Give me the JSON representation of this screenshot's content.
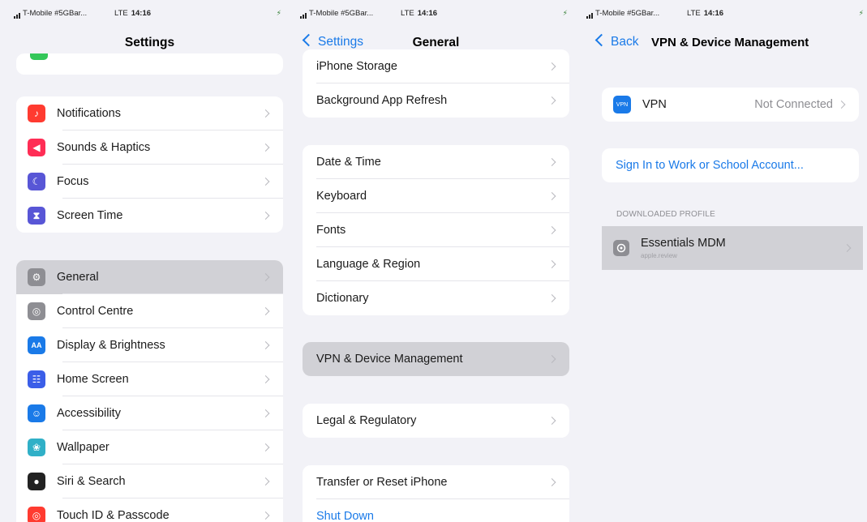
{
  "status": {
    "carrier": "T-Mobile #5GBar...",
    "network": "LTE",
    "time": "14:16",
    "battery": "⚡"
  },
  "screen1": {
    "title": "Settings",
    "group1": [
      {
        "label": "Notifications",
        "icon": "bell-icon",
        "color": "#ff3b30"
      },
      {
        "label": "Sounds & Haptics",
        "icon": "speaker-icon",
        "color": "#ff2d55"
      },
      {
        "label": "Focus",
        "icon": "moon-icon",
        "color": "#5856d6"
      },
      {
        "label": "Screen Time",
        "icon": "hourglass-icon",
        "color": "#5856d6"
      }
    ],
    "group2": [
      {
        "label": "General",
        "icon": "gear-icon",
        "color": "#8e8e93"
      },
      {
        "label": "Control Centre",
        "icon": "toggles-icon",
        "color": "#8e8e93"
      },
      {
        "label": "Display & Brightness",
        "icon": "aa-icon",
        "color": "#1a7ae8"
      },
      {
        "label": "Home Screen",
        "icon": "grid-icon",
        "color": "#3b5ee8"
      },
      {
        "label": "Accessibility",
        "icon": "accessibility-icon",
        "color": "#1a7ae8"
      },
      {
        "label": "Wallpaper",
        "icon": "flower-icon",
        "color": "#30b0c7"
      },
      {
        "label": "Siri & Search",
        "icon": "siri-icon",
        "color": "#222222"
      },
      {
        "label": "Touch ID & Passcode",
        "icon": "fingerprint-icon",
        "color": "#ff3b30"
      }
    ]
  },
  "screen2": {
    "back": "Settings",
    "title": "General",
    "group1": [
      "iPhone Storage",
      "Background App Refresh"
    ],
    "group2": [
      "Date & Time",
      "Keyboard",
      "Fonts",
      "Language & Region",
      "Dictionary"
    ],
    "group3": [
      "VPN & Device Management"
    ],
    "group4": [
      "Legal & Regulatory"
    ],
    "group5": [
      "Transfer or Reset iPhone",
      "Shut Down"
    ]
  },
  "screen3": {
    "back": "Back",
    "title": "VPN & Device Management",
    "vpn_label": "VPN",
    "vpn_icon": "VPN",
    "vpn_status": "Not Connected",
    "sign_in": "Sign In to Work or School Account...",
    "section": "DOWNLOADED PROFILE",
    "profile_name": "Essentials MDM",
    "profile_sub": "apple.review"
  },
  "colors": {
    "accent": "#1a7ae8",
    "background": "#f2f2f7",
    "selected": "#d1d1d6"
  }
}
